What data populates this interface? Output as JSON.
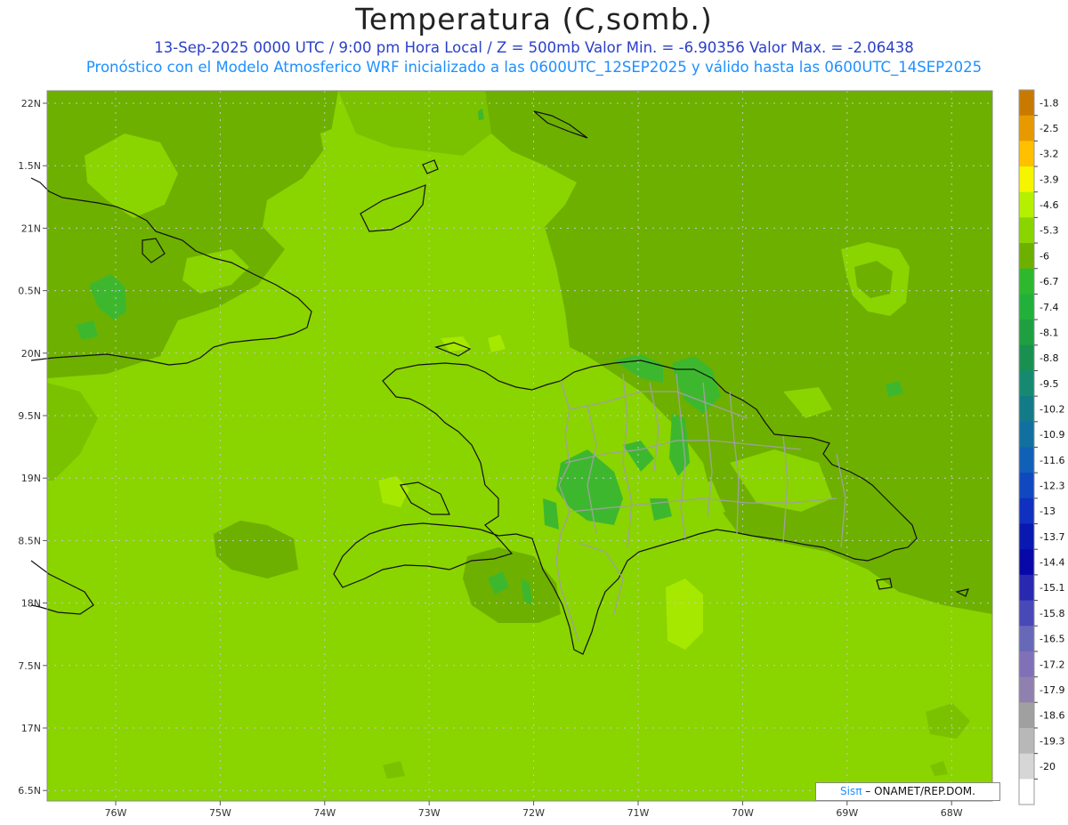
{
  "header": {
    "title": "Temperatura (C,somb.)",
    "subtitle_line1": "13-Sep-2025  0000 UTC / 9:00 pm Hora Local / Z = 500mb  Valor Min. = -6.90356  Valor Max. = -2.06438",
    "subtitle_line2": "Pronóstico con el Modelo Atmosferico WRF inicializado a las 0600UTC_12SEP2025 y válido hasta las  0600UTC_14SEP2025"
  },
  "map": {
    "lat_labels": [
      "22N",
      "1.5N",
      "21N",
      "0.5N",
      "20N",
      "9.5N",
      "19N",
      "8.5N",
      "18N",
      "7.5N",
      "17N",
      "6.5N"
    ],
    "lon_labels": [
      "76W",
      "75W",
      "74W",
      "73W",
      "72W",
      "71W",
      "70W",
      "69W",
      "68W"
    ],
    "colors": {
      "dominant": "#8ad400",
      "region_dark": "#6db000",
      "patch_mid": "#7ac200",
      "patch_green": "#3db82e",
      "patch_light": "#a6e800",
      "coast": "#111111",
      "borders": "#a0a0a0",
      "grid": "#c8c8c8"
    }
  },
  "colorbar": {
    "labels": [
      "-1.8",
      "-2.5",
      "-3.2",
      "-3.9",
      "-4.6",
      "-5.3",
      "-6",
      "-6.7",
      "-7.4",
      "-8.1",
      "-8.8",
      "-9.5",
      "-10.2",
      "-10.9",
      "-11.6",
      "-12.3",
      "-13",
      "-13.7",
      "-14.4",
      "-15.1",
      "-15.8",
      "-16.5",
      "-17.2",
      "-17.9",
      "-18.6",
      "-19.3",
      "-20"
    ],
    "colors": [
      "#c87a00",
      "#e69a00",
      "#ffc000",
      "#f5f500",
      "#b4f000",
      "#8ad400",
      "#6db000",
      "#2eb82e",
      "#22b03a",
      "#1fa040",
      "#1a9050",
      "#158a70",
      "#137a88",
      "#1170a0",
      "#1060b8",
      "#1048c0",
      "#1030c0",
      "#0818b0",
      "#0808a8",
      "#2828b0",
      "#4848b8",
      "#6868b8",
      "#8070b8",
      "#9080b0",
      "#a0a0a0",
      "#b8b8b8",
      "#d6d6d6",
      "#ffffff"
    ]
  },
  "credit": {
    "sis": "Sisπ",
    "org": " – ONAMET/REP.DOM."
  }
}
